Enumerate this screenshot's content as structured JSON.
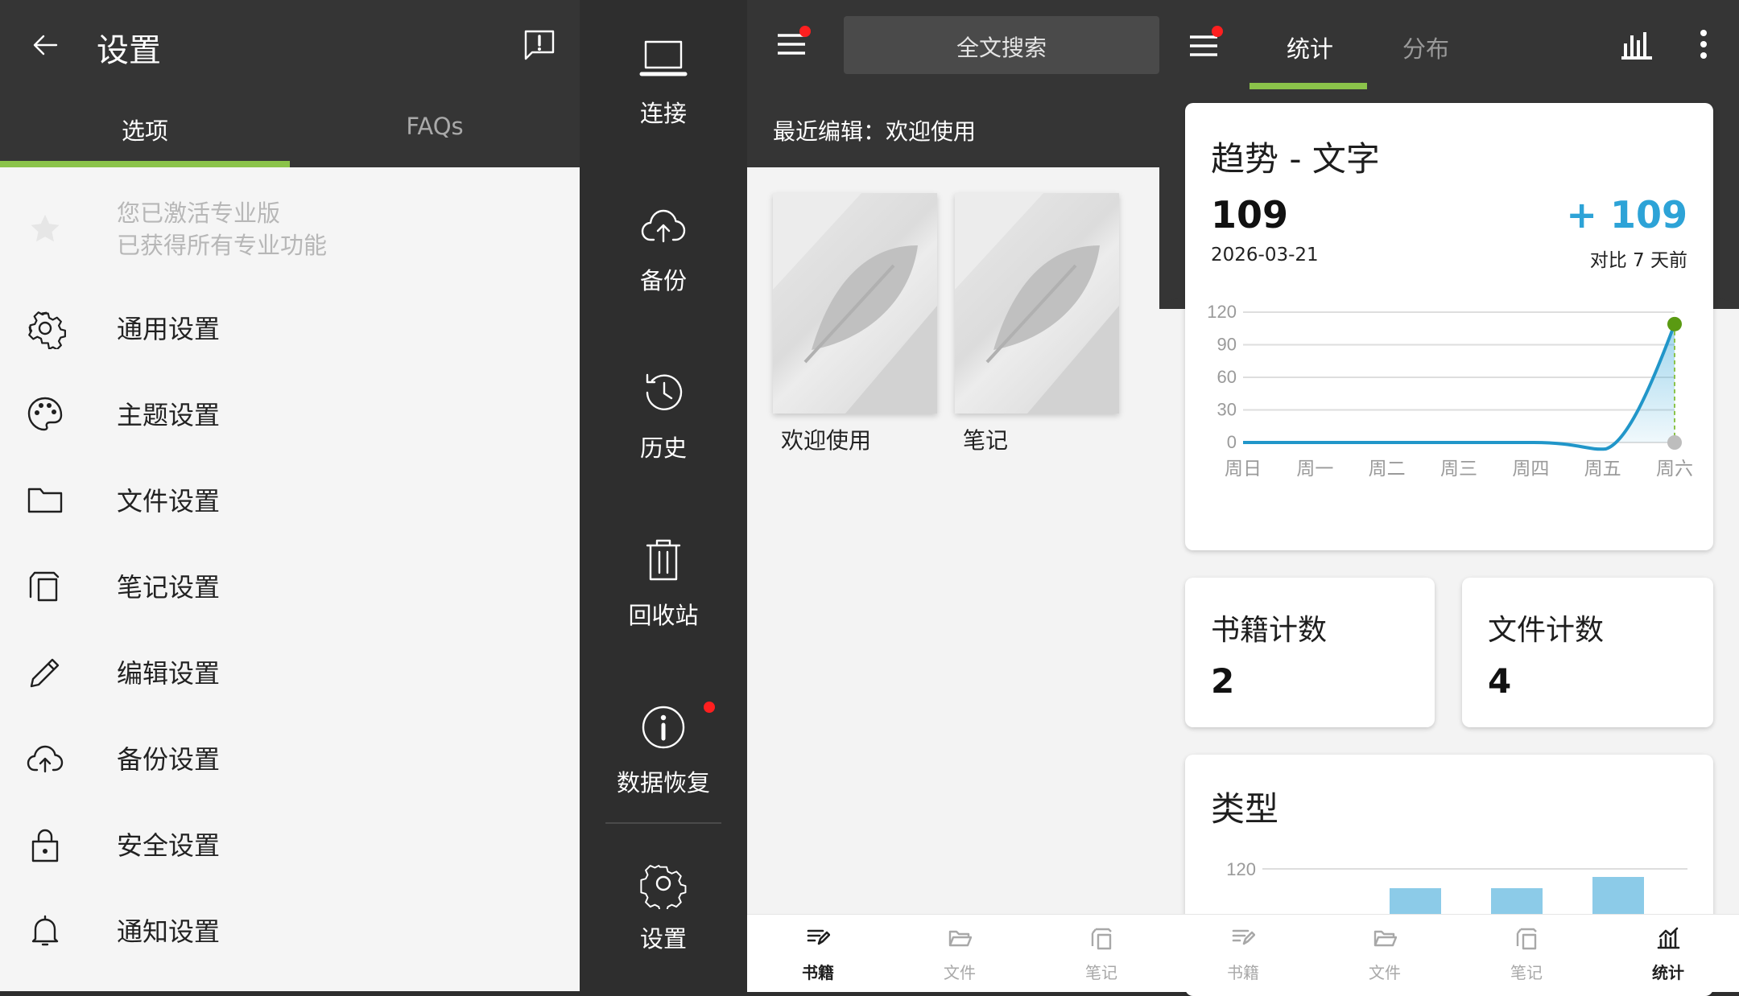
{
  "settings": {
    "title": "设置",
    "tabs": [
      {
        "label": "选项",
        "active": true
      },
      {
        "label": "FAQs",
        "active": false
      }
    ],
    "pro": {
      "line1": "您已激活专业版",
      "line2": "已获得所有专业功能"
    },
    "items": [
      {
        "label": "通用设置",
        "icon": "gear-icon"
      },
      {
        "label": "主题设置",
        "icon": "palette-icon"
      },
      {
        "label": "文件设置",
        "icon": "folder-icon"
      },
      {
        "label": "笔记设置",
        "icon": "notes-icon"
      },
      {
        "label": "编辑设置",
        "icon": "pencil-icon"
      },
      {
        "label": "备份设置",
        "icon": "cloud-upload-icon"
      },
      {
        "label": "安全设置",
        "icon": "lock-icon"
      },
      {
        "label": "通知设置",
        "icon": "bell-icon"
      }
    ]
  },
  "drawer": {
    "items": [
      {
        "label": "连接",
        "icon": "laptop-icon"
      },
      {
        "label": "备份",
        "icon": "cloud-upload-icon"
      },
      {
        "label": "历史",
        "icon": "history-icon"
      },
      {
        "label": "回收站",
        "icon": "trash-icon"
      },
      {
        "label": "数据恢复",
        "icon": "info-icon",
        "badge": true
      },
      {
        "label": "设置",
        "icon": "gear-icon"
      }
    ]
  },
  "books": {
    "search_placeholder": "全文搜索",
    "recent": "最近编辑：欢迎使用",
    "items": [
      {
        "title": "欢迎使用"
      },
      {
        "title": "笔记"
      }
    ]
  },
  "stats": {
    "tabs": [
      {
        "label": "统计",
        "active": true
      },
      {
        "label": "分布",
        "active": false
      }
    ],
    "trend": {
      "title": "趋势 - 文字",
      "value": "109",
      "date": "2026-03-21",
      "delta": "+ 109",
      "compare": "对比 7 天前"
    },
    "book_count": {
      "label": "书籍计数",
      "value": "2"
    },
    "file_count": {
      "label": "文件计数",
      "value": "4"
    },
    "type_title": "类型"
  },
  "chart_data": [
    {
      "type": "line",
      "title": "趋势 - 文字",
      "categories": [
        "周日",
        "周一",
        "周二",
        "周三",
        "周四",
        "周五",
        "周六"
      ],
      "series": [
        {
          "values": [
            0,
            0,
            0,
            0,
            0,
            0,
            109
          ]
        }
      ],
      "yticks": [
        0,
        30,
        60,
        90,
        120
      ],
      "ylim": [
        0,
        120
      ],
      "grid": true
    },
    {
      "type": "bar",
      "title": "类型",
      "yticks": [
        120
      ],
      "visible_partial": true
    }
  ],
  "bottom_nav": [
    {
      "label": "书籍",
      "icon": "book-edit-icon",
      "active": true
    },
    {
      "label": "文件",
      "icon": "folder-open-icon",
      "active": false
    },
    {
      "label": "笔记",
      "icon": "notes-icon",
      "active": false
    },
    {
      "label": "书籍",
      "icon": "book-edit-icon",
      "active": false
    },
    {
      "label": "文件",
      "icon": "folder-open-icon",
      "active": false
    },
    {
      "label": "笔记",
      "icon": "notes-icon",
      "active": false
    },
    {
      "label": "统计",
      "icon": "chart-icon",
      "active": true
    }
  ],
  "colors": {
    "header": "#353535",
    "accent": "#8bc34a",
    "blue": "#2da3d7",
    "badge": "#ff1f1f"
  }
}
